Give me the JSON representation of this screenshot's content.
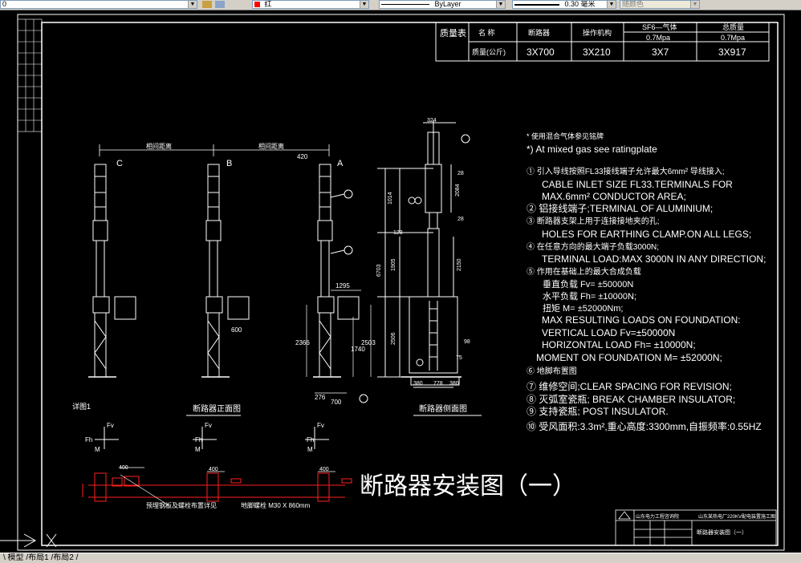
{
  "toolbar": {
    "layer_value": "0",
    "color_value": "红",
    "linetype_value": "ByLayer",
    "lineweight_value": "0.30 毫米",
    "plotstyle_value": "随颜色",
    "color_swatch": "#ff0000"
  },
  "quality_table": {
    "title": "质量表",
    "headers": [
      "名 称",
      "断路器",
      "操作机构",
      "SF6—气体",
      "总质量"
    ],
    "subvalues": [
      "0.7Mpa",
      "0.7Mpa"
    ],
    "row_label": "质量(公斤)",
    "values": [
      "3X700",
      "3X210",
      "3X7",
      "3X917"
    ]
  },
  "notes": {
    "lines": [
      "* 使用混合气体参见铭牌",
      "*) At mixed gas see ratingplate",
      "① 引入导线按照FL33接线端子允许最大6mm² 导线接入;",
      "CABLE INLET SIZE FL33.TERMINALS FOR",
      "MAX.6mm² CONDUCTOR AREA;",
      "② 铝接线端子;TERMINAL OF ALUMINIUM;",
      "③ 断路器支架上用于连接接地夹的孔;",
      "HOLES FOR EARTHING CLAMP.ON   ALL   LEGS;",
      "④ 在任意方向的最大端子负载3000N;",
      "TERMINAL LOAD:MAX 3000N IN ANY DIRECTION;",
      "⑤ 作用在基础上的最大合成负载",
      "垂直负载       Fv= ±50000N",
      "水平负载       Fh= ±10000N;",
      "扭矩           M= ±52000Nm;",
      "MAX RESULTING LOADS ON FOUNDATION:",
      "VERTICAL LOAD     Fv=±50000N",
      "HORIZONTAL LOAD Fh= ±10000N;",
      "MOMENT ON FOUNDATION M=  ±52000N;",
      "⑥ 地脚布置图",
      "⑦ 维修空间;CLEAR SPACING FOR REVISION;",
      "⑧ 灭弧室瓷瓶; BREAK CHAMBER INSULATOR;",
      "⑨ 支持瓷瓶; POST INSULATOR.",
      "⑩ 受风面积:3.3m²,重心高度:3300mm,自振频率:0.55HZ"
    ]
  },
  "front_view": {
    "phase_labels": [
      "C",
      "B",
      "A"
    ],
    "dims_top": [
      "相间距离",
      "相间距离",
      "420"
    ],
    "dims_side": [
      "2366",
      "2503",
      "1740",
      "1295",
      "600",
      "276",
      "700"
    ],
    "detail_label": "详图1",
    "caption": "断路器正面图"
  },
  "side_view": {
    "dims": [
      "324",
      "324",
      "1014",
      "2084",
      "28",
      "28",
      "123",
      "1905",
      "2150",
      "6703",
      "2506",
      "98",
      "75",
      "380",
      "778",
      "380"
    ],
    "caption": "断路器侧面图"
  },
  "foundation": {
    "force_labels": [
      "Fv",
      "Fh",
      "M"
    ],
    "bolt_dims": [
      "400",
      "400",
      "400"
    ],
    "note_left": "预埋钢板及螺栓布置详见",
    "note_right": "地脚螺栓 M30 X 860mm"
  },
  "drawing_title": "断路器安装图（一）",
  "title_block": {
    "org": "山东电力工程咨询院",
    "project": "山东某热电厂220KV配电装置施工图",
    "sheet_title": "断路器安装图（一）"
  },
  "statusbar": {
    "tabs_text": "\\ 模型 /布局1 /布局2 /"
  }
}
